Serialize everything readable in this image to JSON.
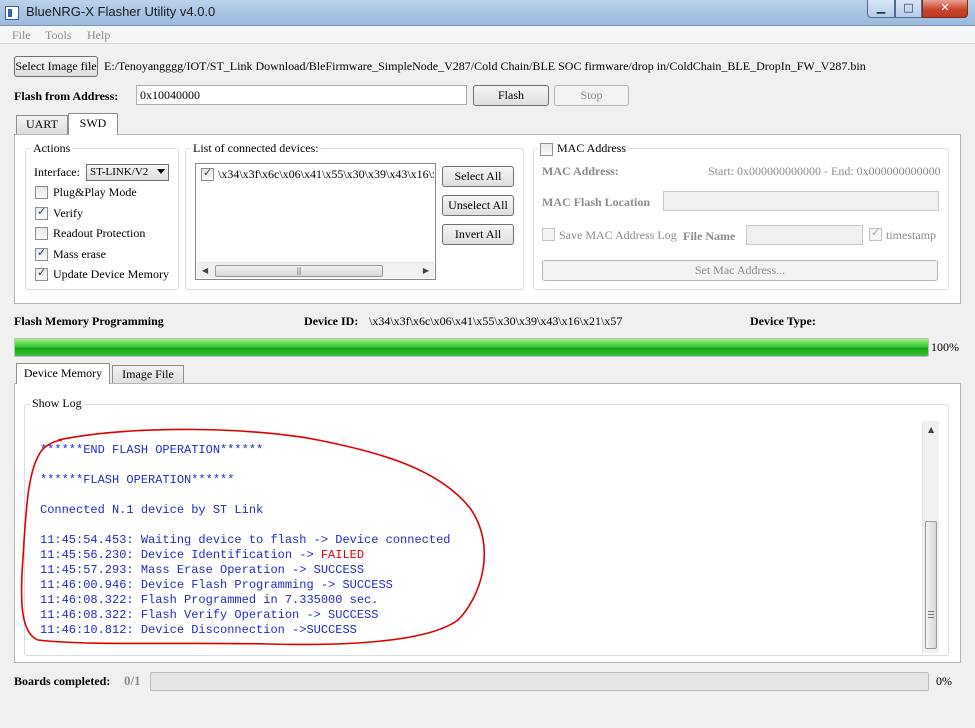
{
  "window": {
    "title": "BlueNRG-X Flasher Utility v4.0.0",
    "minimize": "▁",
    "maximize": "□",
    "close": "✕"
  },
  "menu": [
    "File",
    "Tools",
    "Help"
  ],
  "select_image_label": "Select Image file",
  "image_path": "E:/Tenoyangggg/IOT/ST_Link Download/BleFirmware_SimpleNode_V287/Cold Chain/BLE SOC firmware/drop in/ColdChain_BLE_DropIn_FW_V287.bin",
  "flash_from_label": "Flash from Address:",
  "flash_address": "0x10040000",
  "flash_button": "Flash",
  "stop_button": "Stop",
  "tabs": [
    "UART",
    "SWD"
  ],
  "actions": {
    "title": "Actions",
    "interface_label": "Interface:",
    "interface_value": "ST-LINK/V2",
    "options": [
      {
        "label": "Plug&Play Mode",
        "checked": false
      },
      {
        "label": "Verify",
        "checked": true
      },
      {
        "label": "Readout Protection",
        "checked": false
      },
      {
        "label": "Mass erase",
        "checked": true
      },
      {
        "label": "Update Device Memory",
        "checked": true
      }
    ]
  },
  "devices": {
    "title": "List of connected devices:",
    "item": "\\x34\\x3f\\x6c\\x06\\x41\\x55\\x30\\x39\\x43\\x16\\x",
    "select_all": "Select All",
    "unselect_all": "Unselect All",
    "invert_all": "Invert All"
  },
  "mac": {
    "checkbox_label": "MAC Address",
    "address_label": "MAC Address:",
    "range": "Start: 0x000000000000 - End: 0x000000000000",
    "flash_location_label": "MAC Flash Location",
    "save_log_label": "Save MAC Address Log",
    "file_name_label": "File Name",
    "timestamp_label": "timestamp",
    "set_button": "Set Mac Address..."
  },
  "flash_memory": {
    "label": "Flash Memory Programming",
    "device_id_label": "Device ID:",
    "device_id": "\\x34\\x3f\\x6c\\x06\\x41\\x55\\x30\\x39\\x43\\x16\\x21\\x57",
    "device_type_label": "Device Type:",
    "progress_text": "100%",
    "progress": 1.0
  },
  "bottom_tabs": [
    "Device Memory",
    "Image File"
  ],
  "show_log_label": "Show Log",
  "log": [
    {
      "text": "******END FLASH OPERATION******"
    },
    {
      "text": "******FLASH OPERATION******"
    },
    {
      "text": "Connected N.1 device by ST Link"
    },
    {
      "text": "11:45:54.453: Waiting device to flash -> Device connected"
    },
    {
      "text": "11:45:56.230: Device Identification -> ",
      "status": "FAILED"
    },
    {
      "text": "11:45:57.293: Mass Erase Operation -> SUCCESS"
    },
    {
      "text": "11:46:00.946: Device Flash Programming -> SUCCESS"
    },
    {
      "text": "11:46:08.322: Flash Programmed in 7.335000 sec."
    },
    {
      "text": "11:46:08.322: Flash Verify Operation -> SUCCESS"
    },
    {
      "text": "11:46:10.812: Device Disconnection ->SUCCESS"
    }
  ],
  "boards": {
    "label": "Boards completed:",
    "value": "0/1",
    "percent_text": "0%",
    "progress": 0
  },
  "colors": {
    "log_text": "#1f2bcc",
    "failed": "#e00000",
    "progress": "#22b522",
    "annotation": "#e00000"
  }
}
